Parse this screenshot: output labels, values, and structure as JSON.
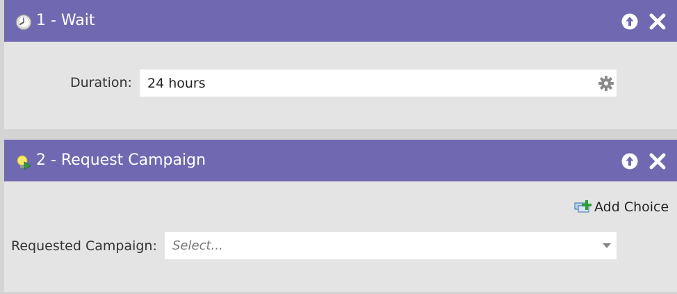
{
  "steps": [
    {
      "title": "1 - Wait",
      "icon": "clock-icon",
      "fields": [
        {
          "label": "Duration:",
          "value": "24 hours",
          "control_icon": "gear-icon"
        }
      ]
    },
    {
      "title": "2 - Request Campaign",
      "icon": "lightbulb-run-icon",
      "add_choice_label": "Add Choice",
      "fields": [
        {
          "label": "Requested Campaign:",
          "placeholder": "Select...",
          "control_icon": "chevron-down-icon"
        }
      ]
    }
  ],
  "header_actions": [
    "move-up-icon",
    "close-icon"
  ],
  "colors": {
    "header_bg": "#7069b1",
    "panel_bg": "#e4e4e4",
    "page_bg": "#d4d4d4",
    "field_bg": "#ffffff"
  }
}
